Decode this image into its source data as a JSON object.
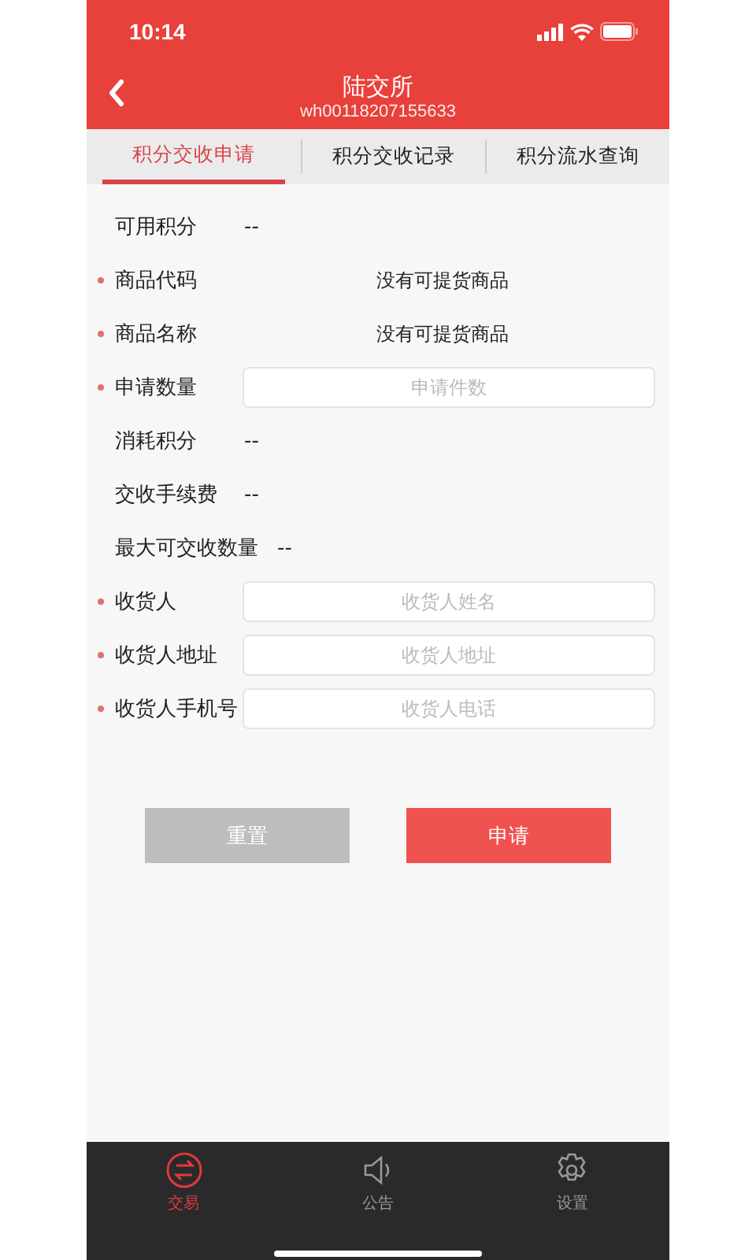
{
  "status_bar": {
    "time": "10:14"
  },
  "header": {
    "title": "陆交所",
    "subtitle": "wh00118207155633"
  },
  "tabs": [
    {
      "label": "积分交收申请",
      "selected": true
    },
    {
      "label": "积分交收记录",
      "selected": false
    },
    {
      "label": "积分流水查询",
      "selected": false
    }
  ],
  "form": [
    {
      "kind": "text",
      "label": "可用积分",
      "required": false,
      "value": "--"
    },
    {
      "kind": "centered",
      "label": "商品代码",
      "required": true,
      "value": "没有可提货商品"
    },
    {
      "kind": "centered",
      "label": "商品名称",
      "required": true,
      "value": "没有可提货商品"
    },
    {
      "kind": "input",
      "label": "申请数量",
      "required": true,
      "placeholder": "申请件数"
    },
    {
      "kind": "text",
      "label": "消耗积分",
      "required": false,
      "value": "--"
    },
    {
      "kind": "text",
      "label": "交收手续费",
      "required": false,
      "value": "--"
    },
    {
      "kind": "text",
      "label": "最大可交收数量",
      "required": false,
      "value": "--"
    },
    {
      "kind": "input",
      "label": "收货人",
      "required": true,
      "placeholder": "收货人姓名"
    },
    {
      "kind": "input",
      "label": "收货人地址",
      "required": true,
      "placeholder": "收货人地址"
    },
    {
      "kind": "input",
      "label": "收货人手机号",
      "required": true,
      "placeholder": "收货人电话"
    }
  ],
  "buttons": [
    {
      "kind": "reset",
      "label": "重置"
    },
    {
      "kind": "submit",
      "label": "申请"
    }
  ],
  "bottom_nav": [
    {
      "kind": "trade",
      "label": "交易",
      "selected": true
    },
    {
      "kind": "notice",
      "label": "公告",
      "selected": false
    },
    {
      "kind": "settings",
      "label": "设置",
      "selected": false
    }
  ]
}
